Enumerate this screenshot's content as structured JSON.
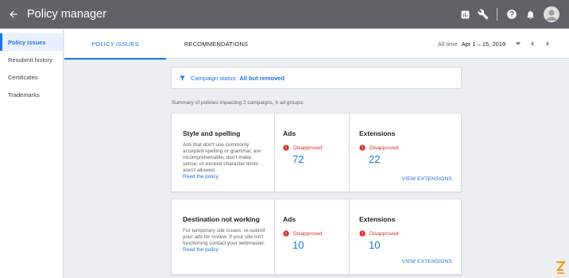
{
  "app": {
    "title": "Policy manager"
  },
  "topbar": {
    "icons": [
      "back-arrow-icon",
      "chart-icon",
      "wrench-icon",
      "help-icon",
      "bell-icon",
      "avatar"
    ]
  },
  "sidebar": {
    "items": [
      {
        "label": "Policy issues",
        "active": true
      },
      {
        "label": "Resubmit history",
        "active": false
      },
      {
        "label": "Certificates",
        "active": false
      },
      {
        "label": "Trademarks",
        "active": false
      }
    ]
  },
  "tabs": [
    {
      "label": "POLICY ISSUES",
      "active": true
    },
    {
      "label": "RECOMMENDATIONS",
      "active": false
    }
  ],
  "date_range": {
    "label": "All time",
    "value": "Apr 1 – 15, 2019"
  },
  "filter": {
    "label": "Campaign status:",
    "value": "All but removed"
  },
  "summary": "Summary of policies impacting 2 campaigns, 6 ad groups:",
  "cards": [
    {
      "title": "Style and spelling",
      "description": "Ads that don't use commonly accepted spelling or grammar, are incomprehensible, don't make sense, or exceed character limits aren't allowed.",
      "link": "Read the policy",
      "ads": {
        "header": "Ads",
        "status": "Disapproved",
        "count": "72"
      },
      "extensions": {
        "header": "Extensions",
        "status": "Disapproved",
        "count": "22",
        "action": "VIEW EXTENSIONS"
      }
    },
    {
      "title": "Destination not working",
      "description": "For temporary site issues, re-submit your ads for review. If your site isn't functioning contact your webmaster.",
      "link": "Read the policy",
      "ads": {
        "header": "Ads",
        "status": "Disapproved",
        "count": "10"
      },
      "extensions": {
        "header": "Extensions",
        "status": "Disapproved",
        "count": "10",
        "action": "VIEW EXTENSIONS"
      }
    }
  ],
  "colors": {
    "topbar": "#5f6368",
    "accent": "#1a73e8",
    "error": "#d93025",
    "background": "#eceff1",
    "brand": "#f29900"
  }
}
